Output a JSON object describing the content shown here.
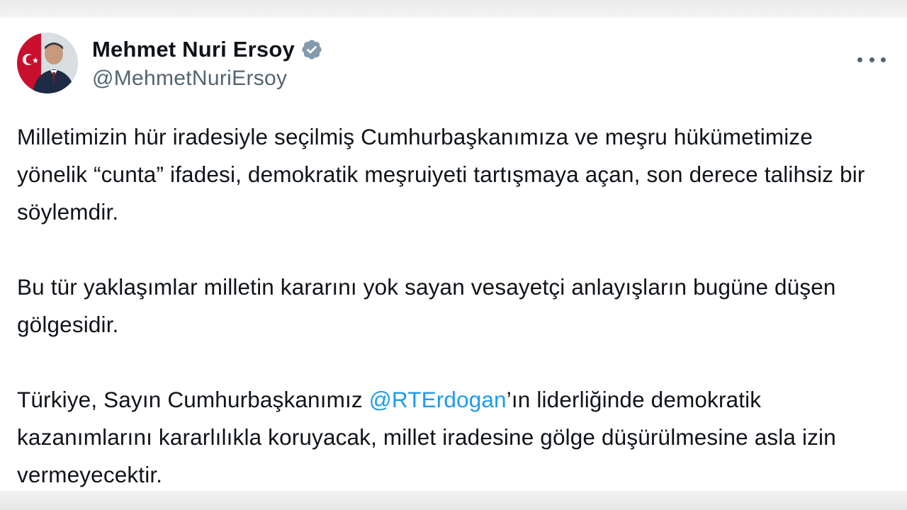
{
  "author": {
    "display_name": "Mehmet Nuri Ersoy",
    "handle": "@MehmetNuriErsoy",
    "verified": true
  },
  "tweet": {
    "paragraph1": "Milletimizin hür iradesiyle seçilmiş Cumhurbaşkanımıza ve meşru hükümetimize yönelik “cunta” ifadesi, demokratik meşruiyeti tartışmaya açan, son derece talihsiz bir söylemdir.",
    "paragraph2": "Bu tür yaklaşımlar milletin kararını yok sayan vesayetçi anlayışların bugüne düşen gölgesidir.",
    "paragraph3_before": "Türkiye, Sayın Cumhurbaşkanımız ",
    "mention": "@RTErdogan",
    "paragraph3_after": "’ın liderliğinde demokratik kazanımlarını kararlılıkla koruyacak, millet iradesine gölge düşürülmesine asla izin vermeyecektir."
  },
  "icons": {
    "verified": "verified-badge-icon",
    "more": "more-options-icon"
  },
  "colors": {
    "text": "#0f1419",
    "secondary": "#536471",
    "link": "#1d9bf0",
    "verified_badge": "#829aab"
  }
}
